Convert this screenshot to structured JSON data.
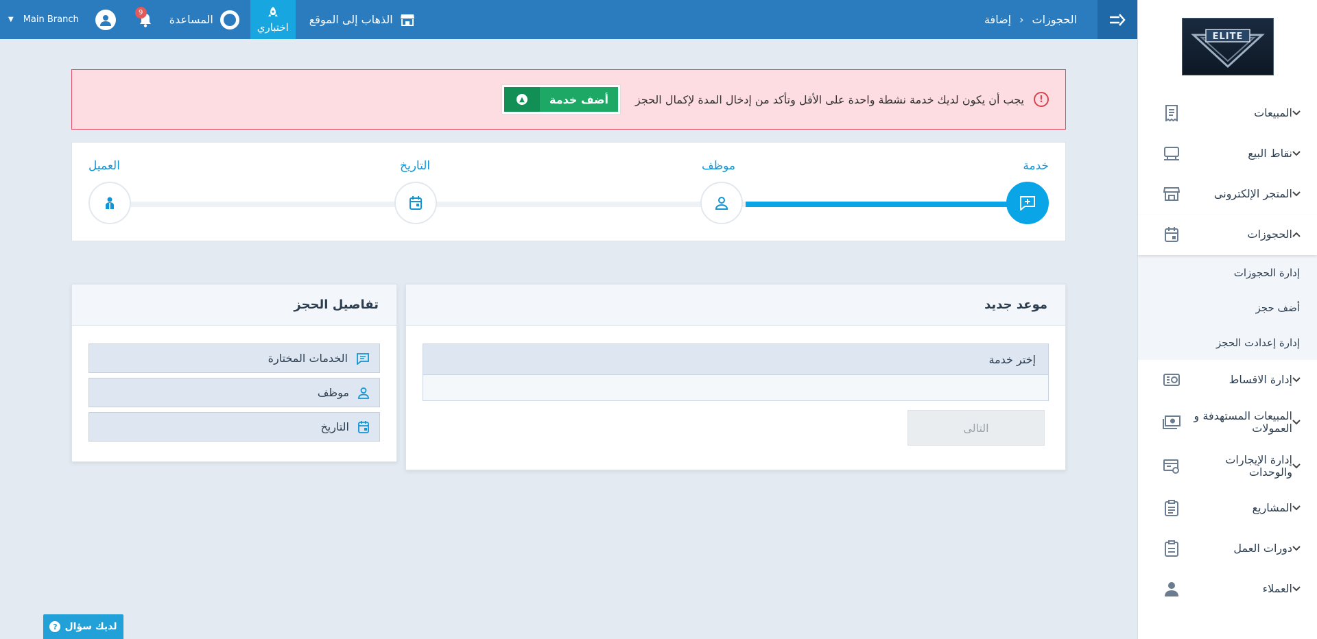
{
  "topbar": {
    "branch": "Main Branch",
    "notifications_count": "9",
    "help_label": "المساعدة",
    "trial_label": "اختباري",
    "site_link_label": "الذهاب إلى الموقع",
    "breadcrumb": [
      "الحجوزات",
      "إضافة"
    ]
  },
  "sidebar": {
    "logo_text": "ELITE",
    "items": [
      {
        "label": "المبيعات",
        "icon": "receipt-icon"
      },
      {
        "label": "نقاط البيع",
        "icon": "pos-terminal-icon"
      },
      {
        "label": "المتجر الإلكترونى",
        "icon": "store-icon"
      },
      {
        "label": "الحجوزات",
        "icon": "calendar-icon",
        "open": true
      },
      {
        "label": "إدارة الاقساط",
        "icon": "installments-icon"
      },
      {
        "label": "المبيعات المستهدفة و العمولات",
        "icon": "cash-icon"
      },
      {
        "label": "إدارة الإيجارات والوحدات",
        "icon": "rental-icon"
      },
      {
        "label": "المشاريع",
        "icon": "clipboard-icon"
      },
      {
        "label": "دورات العمل",
        "icon": "clipboard-list-icon"
      },
      {
        "label": "العملاء",
        "icon": "person-icon"
      }
    ],
    "submenu": [
      "إدارة الحجوزات",
      "أضف حجز",
      "إدارة إعدادت الحجز"
    ]
  },
  "alert": {
    "message": "يجب أن يكون لديك خدمة نشطة واحدة على الأقل وتأكد من إدخال المدة لإكمال الحجز",
    "button_label": "أضف خدمة"
  },
  "stepper": {
    "steps": [
      "خدمة",
      "موظف",
      "التاريخ",
      "العميل"
    ],
    "active_index": 0
  },
  "new_appointment": {
    "title": "موعد جديد",
    "select_label": "إختر خدمة",
    "next_label": "التالى"
  },
  "booking_details": {
    "title": "تفاصيل الحجز",
    "rows": [
      "الخدمات المختارة",
      "موظف",
      "التاريخ"
    ]
  },
  "help_widget": {
    "label": "لديك سؤال"
  },
  "colors": {
    "topbar": "#2b7bbf",
    "accent": "#09a5e6",
    "alert_bg": "#fddde2",
    "alert_border": "#e04b66",
    "success": "#1ea865"
  }
}
